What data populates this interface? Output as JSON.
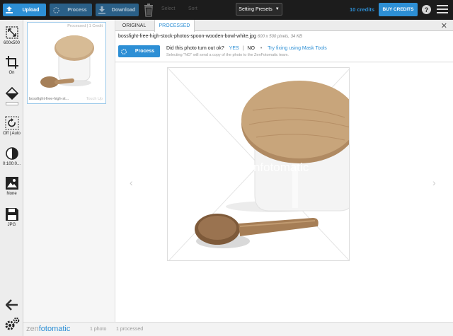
{
  "toolbar": {
    "upload_label": "Upload",
    "process_label": "Process",
    "download_label": "Download",
    "menu_1": "Select",
    "menu_2": "Sort",
    "presets_label": "Setting Presets",
    "credits": "10 credits",
    "buy_label": "BUY CREDITS",
    "help_label": "?",
    "accent": "#2d8fd5"
  },
  "tools": {
    "size": "600x500",
    "crop": "On",
    "rotate": "Off | Auto",
    "levels": "0:100:0...",
    "background": "None",
    "format": "JPG"
  },
  "thumbnail": {
    "status": "Processed | 1 Credit",
    "name": "bossfight-free-high-st...",
    "touch_up": "Touch Up"
  },
  "tabs": {
    "original": "ORIGINAL",
    "processed": "PROCESSED"
  },
  "file": {
    "name": "bossfight-free-high-stock-photos-spoon-wooden-bowl-white.jpg",
    "meta": "600 x 500 pixels, 34 KB"
  },
  "feedback": {
    "process_label": "Process",
    "question": "Did this photo turn out ok?",
    "yes": "YES",
    "no": "NO",
    "bullet": "•",
    "mask_link": "Try fixing using Mask Tools",
    "note": "Selecting \"NO\" will send a copy of the photo to the ZenFotomatic team."
  },
  "watermark": "zenfotomatic",
  "footer": {
    "brand_zen": "zen",
    "brand_foto": "fotomatic",
    "photos": "1 photo",
    "processed": "1 processed"
  }
}
